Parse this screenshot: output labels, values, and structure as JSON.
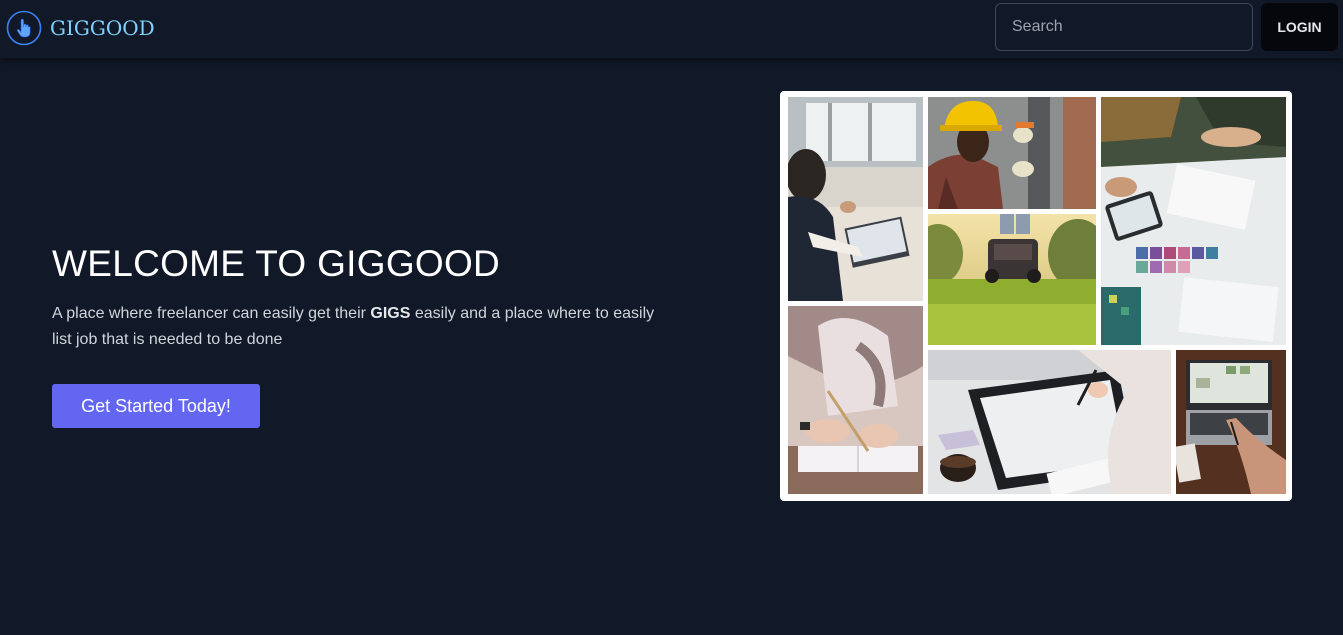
{
  "navbar": {
    "brand_name": "GIGGOOD",
    "logo_icon": "hand-pointer-icon",
    "search_placeholder": "Search",
    "login_label": "LOGIN"
  },
  "hero": {
    "title": "WELCOME TO GIGGOOD",
    "text_before": "A place where freelancer can easily get their ",
    "text_bold": "GIGS",
    "text_after": " easily and a place where to easily list job that is needed to be done",
    "cta_label": "Get Started Today!"
  },
  "colors": {
    "background": "#111827",
    "accent": "#6366f1",
    "brand": "#7dd3fc"
  },
  "collage": {
    "photos": [
      "woman-with-laptop-photo",
      "electrician-photo",
      "design-meeting-photo",
      "lawn-mowing-photo",
      "writing-notebook-photo",
      "drawing-tablet-photo",
      "laptop-desk-photo"
    ]
  }
}
